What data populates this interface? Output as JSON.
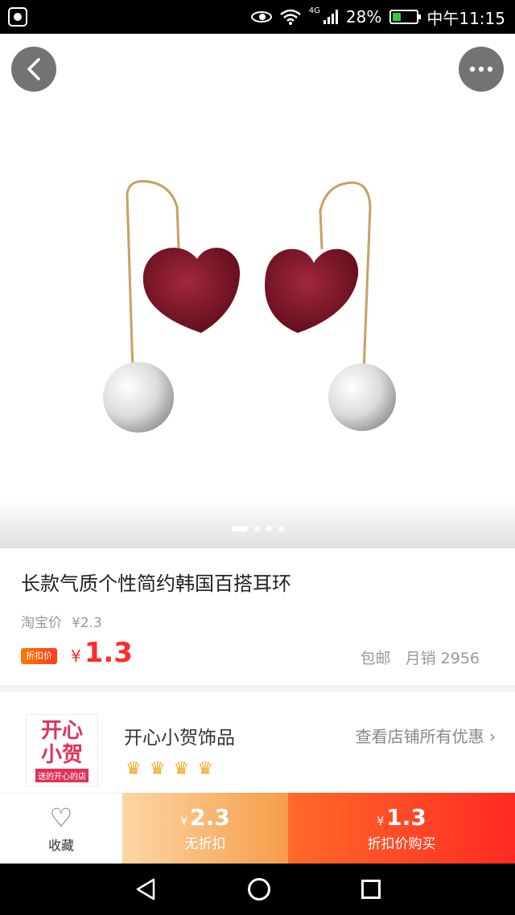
{
  "status_bar": {
    "network": "4G",
    "battery": "28%",
    "time": "中午11:15"
  },
  "hero": {
    "icons": [
      "back-icon",
      "more-icon"
    ],
    "carousel_total": 4,
    "carousel_active": 1
  },
  "product": {
    "title": "长款气质个性简约韩国百搭耳环",
    "original_price_label": "淘宝价",
    "original_price": "¥2.3",
    "discount_tag": "折扣价",
    "price_symbol": "¥",
    "price": "1.3",
    "shipping": "包邮",
    "monthly_sales": "月销 2956"
  },
  "shop": {
    "logo_line1": "开心",
    "logo_line2": "小贺",
    "logo_slogan": "送的开心的店",
    "name": "开心小贺饰品",
    "view_all": "查看店铺所有优惠 ›",
    "crown_count": 4
  },
  "actions": {
    "favorite_label": "收藏",
    "no_discount_price_symbol": "¥",
    "no_discount_price": "2.3",
    "no_discount_label": "无折扣",
    "buy_price_symbol": "¥",
    "buy_price": "1.3",
    "buy_label": "折扣价购买"
  },
  "colors": {
    "accent_red": "#ff2a2a",
    "crown_gold": "#f4a62a",
    "velvet": "#7a1020"
  }
}
